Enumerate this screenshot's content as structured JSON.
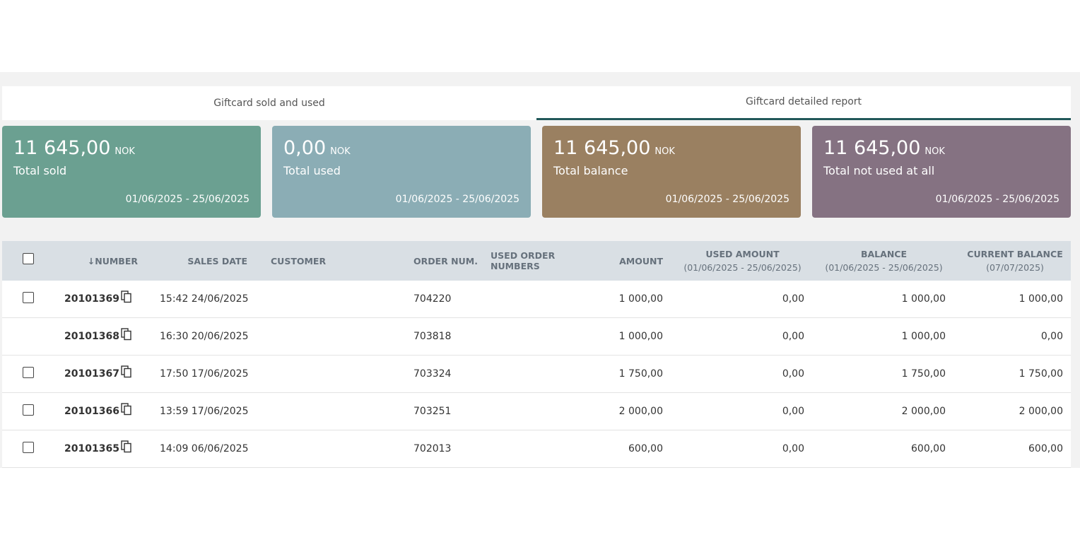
{
  "tabs": [
    {
      "label": "Giftcard sold and used",
      "active": false
    },
    {
      "label": "Giftcard detailed report",
      "active": true
    }
  ],
  "cards": [
    {
      "value": "11 645,00",
      "currency": "NOK",
      "label": "Total sold",
      "range": "01/06/2025 - 25/06/2025",
      "color": "#6ba091"
    },
    {
      "value": "0,00",
      "currency": "NOK",
      "label": "Total used",
      "range": "01/06/2025 - 25/06/2025",
      "color": "#8badb5"
    },
    {
      "value": "11 645,00",
      "currency": "NOK",
      "label": "Total balance",
      "range": "01/06/2025 - 25/06/2025",
      "color": "#9a8061"
    },
    {
      "value": "11 645,00",
      "currency": "NOK",
      "label": "Total not used at all",
      "range": "01/06/2025 - 25/06/2025",
      "color": "#857282"
    }
  ],
  "table": {
    "headers": {
      "number": "NUMBER",
      "sales_date": "SALES DATE",
      "customer": "CUSTOMER",
      "order_num": "ORDER NUM.",
      "used_order_numbers": "USED ORDER NUMBERS",
      "amount": "AMOUNT",
      "used_amount": "USED AMOUNT",
      "used_amount_range": "(01/06/2025 - 25/06/2025)",
      "balance": "BALANCE",
      "balance_range": "(01/06/2025 - 25/06/2025)",
      "current_balance": "CURRENT BALANCE",
      "current_balance_date": "(07/07/2025)"
    },
    "rows": [
      {
        "checkbox": true,
        "number": "20101369",
        "sales_date": "15:42 24/06/2025",
        "customer": "",
        "order_num": "704220",
        "used_order_numbers": "",
        "amount": "1 000,00",
        "used_amount": "0,00",
        "balance": "1 000,00",
        "current_balance": "1 000,00"
      },
      {
        "checkbox": false,
        "number": "20101368",
        "sales_date": "16:30 20/06/2025",
        "customer": "",
        "order_num": "703818",
        "used_order_numbers": "",
        "amount": "1 000,00",
        "used_amount": "0,00",
        "balance": "1 000,00",
        "current_balance": "0,00"
      },
      {
        "checkbox": true,
        "number": "20101367",
        "sales_date": "17:50 17/06/2025",
        "customer": "",
        "order_num": "703324",
        "used_order_numbers": "",
        "amount": "1 750,00",
        "used_amount": "0,00",
        "balance": "1 750,00",
        "current_balance": "1 750,00"
      },
      {
        "checkbox": true,
        "number": "20101366",
        "sales_date": "13:59 17/06/2025",
        "customer": "",
        "order_num": "703251",
        "used_order_numbers": "",
        "amount": "2 000,00",
        "used_amount": "0,00",
        "balance": "2 000,00",
        "current_balance": "2 000,00"
      },
      {
        "checkbox": true,
        "number": "20101365",
        "sales_date": "14:09 06/06/2025",
        "customer": "",
        "order_num": "702013",
        "used_order_numbers": "",
        "amount": "600,00",
        "used_amount": "0,00",
        "balance": "600,00",
        "current_balance": "600,00"
      }
    ]
  },
  "icons": {
    "sort": "arrow-down-icon",
    "copy": "copy-icon",
    "checkbox": "checkbox-icon"
  }
}
